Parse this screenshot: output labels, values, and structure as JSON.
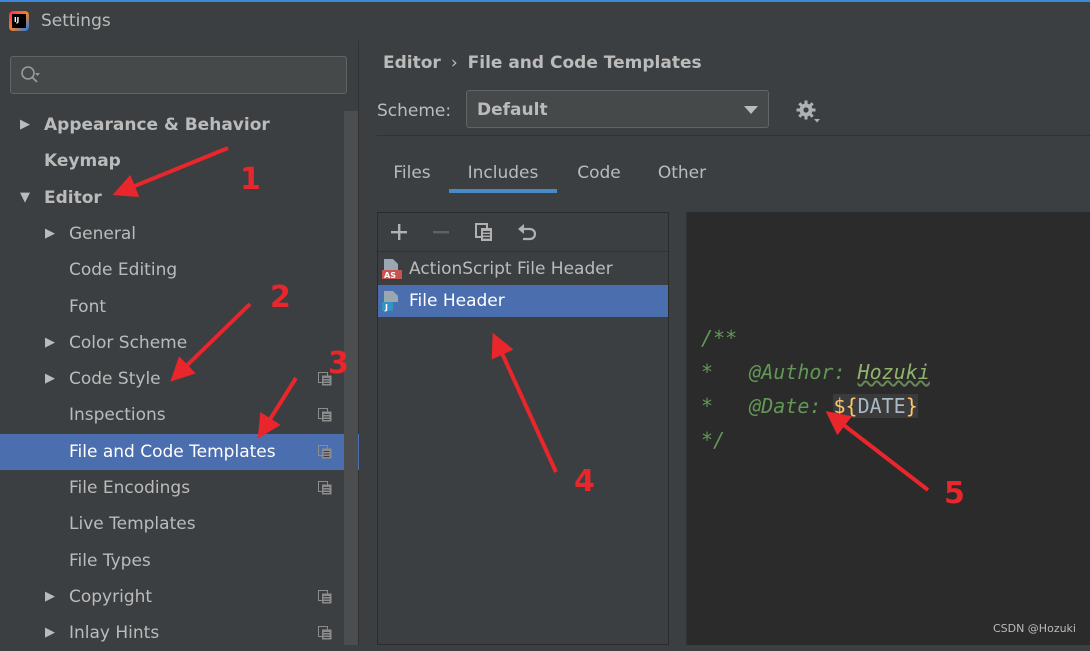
{
  "window": {
    "title": "Settings",
    "app_icon_text": "IJ"
  },
  "search": {
    "placeholder": ""
  },
  "tree": {
    "items": [
      {
        "label": "Appearance & Behavior",
        "arrow": "▶",
        "bold": true
      },
      {
        "label": "Keymap",
        "arrow": "",
        "bold": true
      },
      {
        "label": "Editor",
        "arrow": "▼",
        "bold": true
      },
      {
        "label": "General",
        "arrow": "▶"
      },
      {
        "label": "Code Editing",
        "arrow": ""
      },
      {
        "label": "Font",
        "arrow": ""
      },
      {
        "label": "Color Scheme",
        "arrow": "▶"
      },
      {
        "label": "Code Style",
        "arrow": "▶",
        "project_icon": true
      },
      {
        "label": "Inspections",
        "arrow": "",
        "project_icon": true
      },
      {
        "label": "File and Code Templates",
        "arrow": "",
        "project_icon": true,
        "selected": true
      },
      {
        "label": "File Encodings",
        "arrow": "",
        "project_icon": true
      },
      {
        "label": "Live Templates",
        "arrow": ""
      },
      {
        "label": "File Types",
        "arrow": ""
      },
      {
        "label": "Copyright",
        "arrow": "▶",
        "project_icon": true
      },
      {
        "label": "Inlay Hints",
        "arrow": "▶",
        "project_icon": true
      }
    ]
  },
  "breadcrumb": {
    "parent": "Editor",
    "separator": "›",
    "current": "File and Code Templates"
  },
  "scheme": {
    "label": "Scheme:",
    "value": "Default"
  },
  "tabs": [
    {
      "label": "Files"
    },
    {
      "label": "Includes",
      "active": true
    },
    {
      "label": "Code"
    },
    {
      "label": "Other"
    }
  ],
  "templates": {
    "items": [
      {
        "label": "ActionScript File Header",
        "icon": "actionscript-file-icon",
        "badge": "AS"
      },
      {
        "label": "File Header",
        "icon": "java-file-icon",
        "badge": "J",
        "selected": true
      }
    ]
  },
  "editor": {
    "line1": "/**",
    "line2_star": "*",
    "line2_tag": "@Author:",
    "line2_value": "Hozuki",
    "line3_star": "*",
    "line3_tag": "@Date:",
    "line3_var_open": "${",
    "line3_var_name": "DATE",
    "line3_var_close": "}",
    "line4": "*/"
  },
  "watermark": "CSDN @Hozuki",
  "annotations": [
    "1",
    "2",
    "3",
    "4",
    "5"
  ],
  "colors": {
    "selection": "#4b6eaf",
    "annotation": "#e8262c",
    "accent": "#3d8ad8"
  }
}
